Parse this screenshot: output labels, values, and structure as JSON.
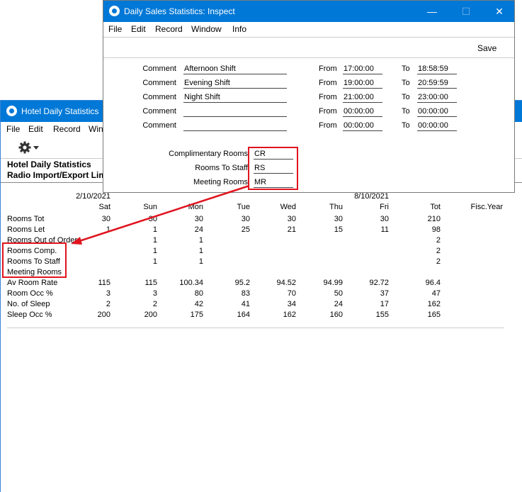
{
  "back_window": {
    "title": "Hotel Daily Statistics",
    "menu": [
      "File",
      "Edit",
      "Record",
      "Win"
    ],
    "header_line1": "Hotel Daily Statistics",
    "header_line2": "Radio Import/Export Lim",
    "report": {
      "date_left": "2/10/2021",
      "date_right": "8/10/2021",
      "columns": [
        "Sat",
        "Sun",
        "Mon",
        "Tue",
        "Wed",
        "Thu",
        "Fri",
        "Tot",
        "Fisc.Year"
      ],
      "rows": [
        {
          "label": "Rooms Tot",
          "values": [
            "30",
            "30",
            "30",
            "30",
            "30",
            "30",
            "30",
            "210",
            ""
          ]
        },
        {
          "label": "Rooms Let",
          "values": [
            "1",
            "1",
            "24",
            "25",
            "21",
            "15",
            "11",
            "98",
            ""
          ]
        },
        {
          "label": "Rooms Out of Order",
          "values": [
            "",
            "1",
            "1",
            "",
            "",
            "",
            "",
            "2",
            ""
          ]
        },
        {
          "label": "Rooms Comp.",
          "values": [
            "",
            "1",
            "1",
            "",
            "",
            "",
            "",
            "2",
            ""
          ]
        },
        {
          "label": "Rooms To Staff",
          "values": [
            "",
            "1",
            "1",
            "",
            "",
            "",
            "",
            "2",
            ""
          ]
        },
        {
          "label": "Meeting Rooms",
          "values": [
            "",
            "",
            "",
            "",
            "",
            "",
            "",
            "",
            ""
          ]
        },
        {
          "label": "Av Room Rate",
          "values": [
            "115",
            "115",
            "100.34",
            "95.2",
            "94.52",
            "94.99",
            "92.72",
            "96.4",
            ""
          ]
        },
        {
          "label": "Room Occ %",
          "values": [
            "3",
            "3",
            "80",
            "83",
            "70",
            "50",
            "37",
            "47",
            ""
          ]
        },
        {
          "label": "No. of Sleep",
          "values": [
            "2",
            "2",
            "42",
            "41",
            "34",
            "24",
            "17",
            "162",
            ""
          ]
        },
        {
          "label": "Sleep Occ %",
          "values": [
            "200",
            "200",
            "175",
            "164",
            "162",
            "160",
            "155",
            "165",
            ""
          ]
        }
      ]
    }
  },
  "front_window": {
    "title": "Daily Sales Statistics: Inspect",
    "menu": [
      "File",
      "Edit",
      "Record",
      "Window",
      "Info"
    ],
    "save_label": "Save",
    "comment_label": "Comment",
    "from_label": "From",
    "to_label": "To",
    "shifts": [
      {
        "comment": "Afternoon Shift",
        "from": "17:00:00",
        "to": "18:58:59"
      },
      {
        "comment": "Evening Shift",
        "from": "19:00:00",
        "to": "20:59:59"
      },
      {
        "comment": "Night Shift",
        "from": "21:00:00",
        "to": "23:00:00"
      },
      {
        "comment": "",
        "from": "00:00:00",
        "to": "00:00:00"
      },
      {
        "comment": "",
        "from": "00:00:00",
        "to": "00:00:00"
      }
    ],
    "codes": [
      {
        "label": "Complimentary Rooms",
        "value": "CR"
      },
      {
        "label": "Rooms To Staff",
        "value": "RS"
      },
      {
        "label": "Meeting Rooms",
        "value": "MR"
      }
    ]
  },
  "colors": {
    "titlebar": "#0078d7",
    "highlight": "#e0141e"
  },
  "icons": {
    "window_logo": "app-logo-icon",
    "options": "gear-icon",
    "minimize": "minimize-icon",
    "maximize": "maximize-icon",
    "close": "close-icon"
  }
}
